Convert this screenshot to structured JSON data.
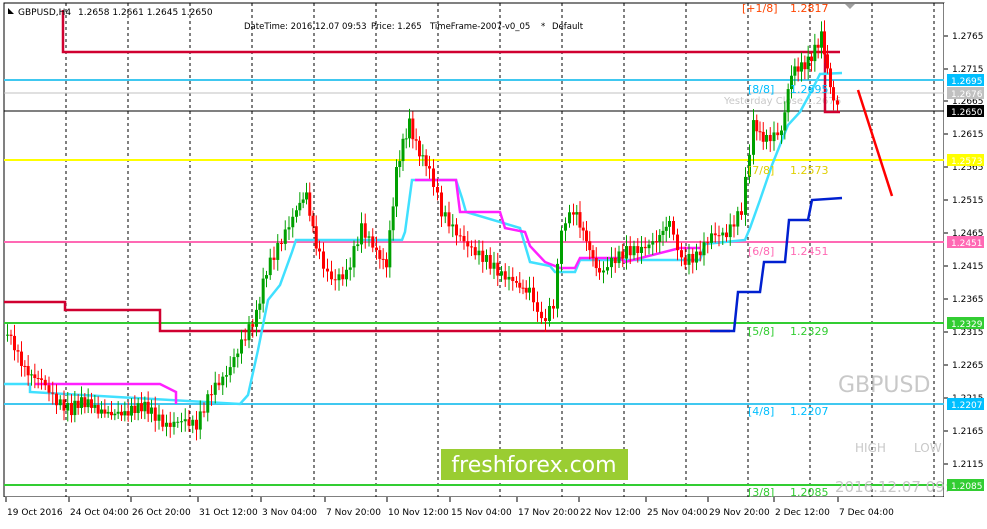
{
  "header": {
    "symbol_tf": "GBPUSD,H4",
    "ohlc": "1.2658 1.2661 1.2645 1.2650"
  },
  "info_bar": {
    "datetime": "DateTime: 2016.12.07 09:53",
    "price": "Price: 1.265",
    "timeframe": "TimeFrame-2007-v0_05",
    "star": "*",
    "default": "Default"
  },
  "watermark": {
    "symbol": "GBPUSD",
    "high_label": "HIGH",
    "low_label": "LOW",
    "date": "2016.12.07 09:",
    "brand": "freshforex.com"
  },
  "yesterday_close": "Yesterday Close 1.2676",
  "price_axis": {
    "ticks": [
      "1.2765",
      "1.2715",
      "1.2665",
      "1.2615",
      "1.2565",
      "1.2515",
      "1.2465",
      "1.2415",
      "1.2365",
      "1.2315",
      "1.2265",
      "1.2215",
      "1.2165",
      "1.2115"
    ],
    "badges": [
      {
        "text": "1.2695",
        "bg": "#00bfff",
        "fg": "#ffffff"
      },
      {
        "text": "1.2676",
        "bg": "#c0c0c0",
        "fg": "#ffffff"
      },
      {
        "text": "1.2650",
        "bg": "#000000",
        "fg": "#ffffff"
      },
      {
        "text": "1.2573",
        "bg": "#ffff00",
        "fg": "#ffffff"
      },
      {
        "text": "1.2451",
        "bg": "#ff69b4",
        "fg": "#ffffff"
      },
      {
        "text": "1.2329",
        "bg": "#32cd32",
        "fg": "#ffffff"
      },
      {
        "text": "1.2207",
        "bg": "#00bfff",
        "fg": "#ffffff"
      },
      {
        "text": "1.2085",
        "bg": "#32cd32",
        "fg": "#ffffff"
      }
    ]
  },
  "time_axis": [
    "19 Oct 2016",
    "24 Oct 04:00",
    "26 Oct 20:00",
    "31 Oct 12:00",
    "3 Nov 04:00",
    "7 Nov 20:00",
    "10 Nov 12:00",
    "15 Nov 04:00",
    "17 Nov 20:00",
    "22 Nov 12:00",
    "25 Nov 04:00",
    "29 Nov 20:00",
    "2 Dec 12:00",
    "7 Dec 04:00"
  ],
  "murrey_labels": [
    {
      "tag": "[+1/8]",
      "value": "1.2817",
      "color": "#ff4500"
    },
    {
      "tag": "[8/8]",
      "value": "1.2695",
      "color": "#00bfff"
    },
    {
      "tag": "[7/8]",
      "value": "1.2573",
      "color": "#ffff00"
    },
    {
      "tag": "[6/8]",
      "value": "1.2451",
      "color": "#ff69b4"
    },
    {
      "tag": "[5/8]",
      "value": "1.2329",
      "color": "#32cd32"
    },
    {
      "tag": "[4/8]",
      "value": "1.2207",
      "color": "#00bfff"
    },
    {
      "tag": "[3/8]",
      "value": "1.2085",
      "color": "#32cd32"
    }
  ],
  "colors": {
    "bull": "#00a000",
    "bear": "#ff0000",
    "red_line": "#d00030",
    "cyan_line": "#40e0ff",
    "magenta_line": "#ff20ff",
    "blue_line": "#0020d0",
    "grid": "#000000",
    "brand_bg": "#9acd32"
  },
  "icons": {
    "scroll_arrow": "triangle-down-icon"
  }
}
